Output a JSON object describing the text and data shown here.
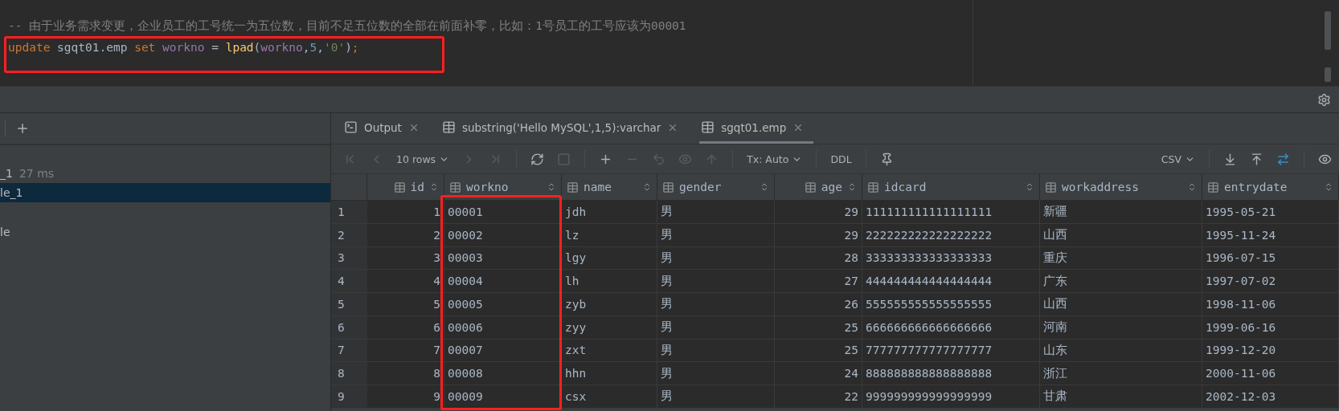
{
  "editor": {
    "comment": "-- 由于业务需求变更，企业员工的工号统一为五位数，目前不足五位数的全部在前面补零，比如：1号员工的工号应该为00001",
    "code": [
      {
        "kind": "keyword",
        "text": "update"
      },
      {
        "kind": "plain",
        "text": " sgqt01.emp "
      },
      {
        "kind": "keyword",
        "text": "set"
      },
      {
        "kind": "column",
        "text": " workno"
      },
      {
        "kind": "plain",
        "text": " = "
      },
      {
        "kind": "function",
        "text": "lpad"
      },
      {
        "kind": "plain",
        "text": "("
      },
      {
        "kind": "column",
        "text": "workno"
      },
      {
        "kind": "plain",
        "text": ","
      },
      {
        "kind": "number",
        "text": "5"
      },
      {
        "kind": "plain",
        "text": ","
      },
      {
        "kind": "string",
        "text": "'0'"
      },
      {
        "kind": "plain",
        "text": ")"
      },
      {
        "kind": "keyword",
        "text": ";"
      }
    ]
  },
  "services": {
    "items": [
      {
        "text": "_1",
        "time": "27 ms",
        "selected": false
      },
      {
        "text": "le_1",
        "selected": true
      },
      {
        "text": "le",
        "selected": false
      }
    ]
  },
  "tabs": [
    {
      "kind": "output",
      "label": "Output",
      "selected": false
    },
    {
      "kind": "table",
      "label": "substring('Hello MySQL',1,5):varchar",
      "selected": false
    },
    {
      "kind": "table",
      "label": "sgqt01.emp",
      "selected": true
    }
  ],
  "toolbar": {
    "left": [
      {
        "kind": "first",
        "disabled": true
      },
      {
        "kind": "prev",
        "disabled": true
      },
      {
        "kind": "dropdown",
        "label": "10 rows",
        "disabled": false
      },
      {
        "kind": "next",
        "disabled": true
      },
      {
        "kind": "last",
        "disabled": true
      },
      {
        "kind": "separator"
      },
      {
        "kind": "refresh",
        "disabled": false
      },
      {
        "kind": "stop",
        "disabled": true
      },
      {
        "kind": "separator"
      },
      {
        "kind": "add",
        "disabled": false
      },
      {
        "kind": "remove",
        "disabled": true
      },
      {
        "kind": "revert",
        "disabled": true
      },
      {
        "kind": "preview",
        "disabled": true
      },
      {
        "kind": "submit",
        "disabled": true
      },
      {
        "kind": "separator"
      },
      {
        "kind": "dropdown",
        "label": "Tx: Auto",
        "disabled": false
      },
      {
        "kind": "separator"
      },
      {
        "kind": "text",
        "label": "DDL",
        "disabled": false
      },
      {
        "kind": "separator"
      },
      {
        "kind": "pin",
        "disabled": false
      }
    ],
    "right": [
      {
        "kind": "dropdown",
        "label": "CSV",
        "disabled": false
      },
      {
        "kind": "separator"
      },
      {
        "kind": "download",
        "disabled": false
      },
      {
        "kind": "upload",
        "disabled": false
      },
      {
        "kind": "compare",
        "disabled": false
      },
      {
        "kind": "separator"
      },
      {
        "kind": "view",
        "disabled": false
      }
    ]
  },
  "table": {
    "columns": [
      {
        "name": "id",
        "numeric": true
      },
      {
        "name": "workno",
        "numeric": false
      },
      {
        "name": "name",
        "numeric": false
      },
      {
        "name": "gender",
        "numeric": false
      },
      {
        "name": "age",
        "numeric": true
      },
      {
        "name": "idcard",
        "numeric": false
      },
      {
        "name": "workaddress",
        "numeric": false
      },
      {
        "name": "entrydate",
        "numeric": false
      }
    ],
    "rows": [
      {
        "number": "1",
        "cells": [
          "1",
          "00001",
          "jdh",
          "男",
          "29",
          "111111111111111111",
          "新疆",
          "1995-05-21"
        ]
      },
      {
        "number": "2",
        "cells": [
          "2",
          "00002",
          "lz",
          "男",
          "29",
          "222222222222222222",
          "山西",
          "1995-11-24"
        ]
      },
      {
        "number": "3",
        "cells": [
          "3",
          "00003",
          "lgy",
          "男",
          "28",
          "333333333333333333",
          "重庆",
          "1996-07-15"
        ]
      },
      {
        "number": "4",
        "cells": [
          "4",
          "00004",
          "lh",
          "男",
          "27",
          "444444444444444444",
          "广东",
          "1997-07-02"
        ]
      },
      {
        "number": "5",
        "cells": [
          "5",
          "00005",
          "zyb",
          "男",
          "26",
          "555555555555555555",
          "山西",
          "1998-11-06"
        ]
      },
      {
        "number": "6",
        "cells": [
          "6",
          "00006",
          "zyy",
          "男",
          "25",
          "666666666666666666",
          "河南",
          "1999-06-16"
        ]
      },
      {
        "number": "7",
        "cells": [
          "7",
          "00007",
          "zxt",
          "男",
          "25",
          "777777777777777777",
          "山东",
          "1999-12-20"
        ]
      },
      {
        "number": "8",
        "cells": [
          "8",
          "00008",
          "hhn",
          "男",
          "24",
          "888888888888888888",
          "浙江",
          "2000-11-06"
        ]
      },
      {
        "number": "9",
        "cells": [
          "9",
          "00009",
          "csx",
          "男",
          "22",
          "999999999999999999",
          "甘肃",
          "2002-12-03"
        ]
      }
    ]
  }
}
